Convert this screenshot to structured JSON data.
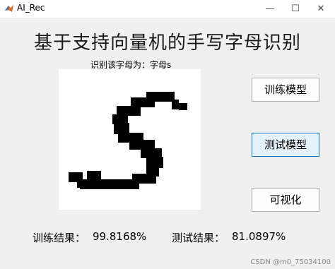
{
  "window": {
    "title": "AI_Rec",
    "controls": {
      "minimize": "—",
      "maximize": "☐",
      "close": "✕"
    },
    "faint_caption": "…………………"
  },
  "main": {
    "title": "基于支持向量机的手写字母识别",
    "result_label": "识别该字母为：字母s"
  },
  "drawing": {
    "recognized_letter": "s",
    "ink_color": "#000000",
    "background_color": "#ffffff"
  },
  "buttons": {
    "train": "训练模型",
    "test": "测试模型",
    "visualize": "可视化"
  },
  "stats": {
    "train_label": "训练结果：",
    "train_value": "99.8168%",
    "test_label": "测试结果：",
    "test_value": "81.0897%"
  },
  "watermark": "CSDN @m0_75034100",
  "colors": {
    "window_bg": "#f0f0f0",
    "button_focus_border": "#0078d7",
    "button_focus_bg": "#e5f1fb"
  }
}
